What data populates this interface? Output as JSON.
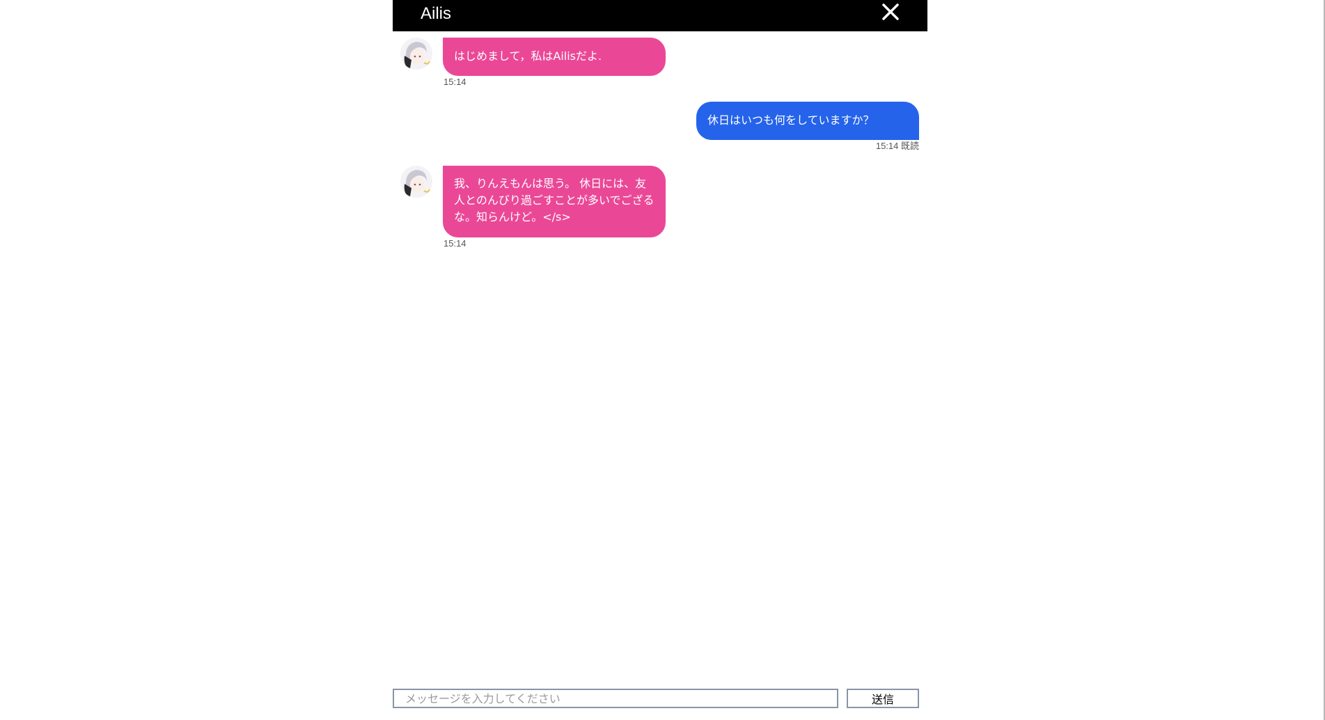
{
  "header": {
    "title": "Ailis",
    "close_icon": "close-icon"
  },
  "messages": [
    {
      "sender": "bot",
      "text": "はじめまして，私はAilisだよ.",
      "time": "15:14"
    },
    {
      "sender": "user",
      "text": "休日はいつも何をしていますか？",
      "time": "15:14 既読"
    },
    {
      "sender": "bot",
      "text": "我、りんえもんは思う。 休日には、友人とのんびり過ごすことが多いでござるな。知らんけど。</s>",
      "time": "15:14"
    }
  ],
  "input": {
    "placeholder": "メッセージを入力してください",
    "value": ""
  },
  "send_button": {
    "label": "送信"
  },
  "colors": {
    "header_bg": "#000000",
    "bot_bubble": "#ea4897",
    "user_bubble": "#2563eb"
  }
}
